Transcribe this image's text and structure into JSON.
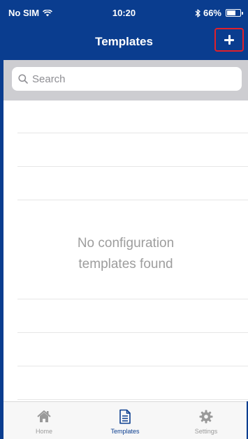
{
  "status_bar": {
    "carrier": "No SIM",
    "time": "10:20",
    "battery": "66%",
    "battery_level": 0.66,
    "icons": [
      "wifi-icon",
      "bluetooth-icon",
      "battery-icon"
    ]
  },
  "nav": {
    "title": "Templates",
    "add_icon": "plus-icon"
  },
  "search": {
    "placeholder": "Search"
  },
  "list": {
    "empty_message": "No configuration templates found"
  },
  "tabs": [
    {
      "label": "Home",
      "icon": "home-icon",
      "active": false
    },
    {
      "label": "Templates",
      "icon": "document-icon",
      "active": true
    },
    {
      "label": "Settings",
      "icon": "gear-icon",
      "active": false
    }
  ],
  "colors": {
    "primary": "#0a3d8f",
    "highlight_border": "#e0202a",
    "search_bg": "#cdcdd1",
    "tab_inactive": "#9a9a9a"
  }
}
